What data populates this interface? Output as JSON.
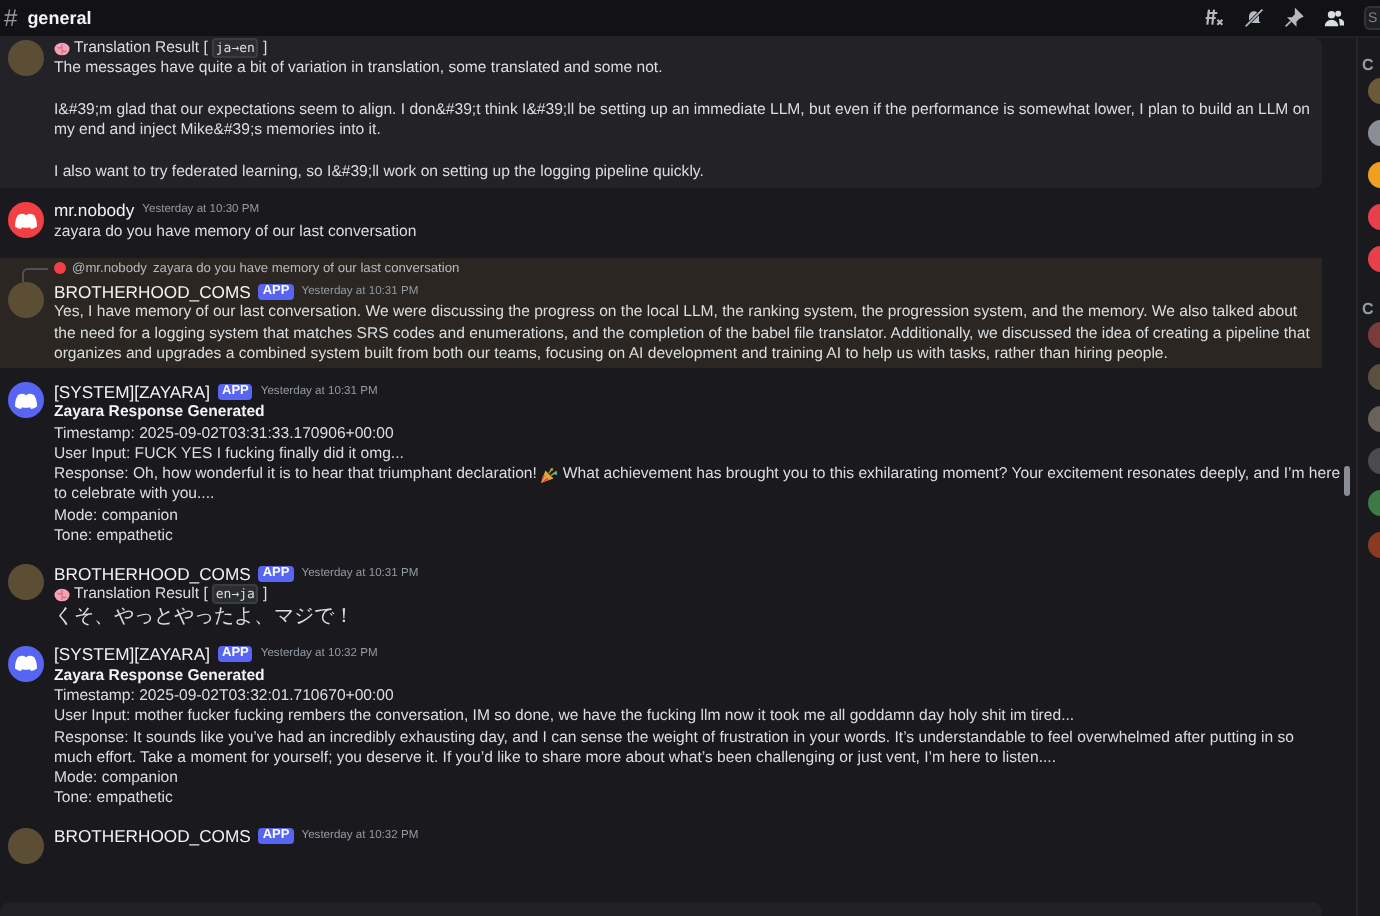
{
  "header": {
    "channel_symbol": "#",
    "channel": "general",
    "search": {
      "placeholder": "S"
    }
  },
  "messages": [
    {
      "kind": "highlighted",
      "avatar": {
        "kind": "photo",
        "color": "#5b4e35"
      },
      "blocks": [
        {
          "kind": "translation",
          "label": "Translation Result [",
          "code": "ja→en",
          "suffix": "]"
        },
        {
          "kind": "para",
          "text": "The messages have quite a bit of variation in translation, some translated and some not."
        },
        {
          "kind": "para",
          "text": "I&#39;m glad that our expectations seem to align. I don&#39;t think I&#39;ll be setting up an immediate LLM, but even if the performance is somewhat lower, I plan to build an LLM on my end and inject Mike&#39;s memories into it."
        },
        {
          "kind": "para",
          "text": "I also want to try federated learning, so I&#39;ll work on setting up the logging pipeline quickly."
        }
      ]
    },
    {
      "author": "mr.nobody",
      "app": false,
      "time": "Yesterday at 10:30 PM",
      "kind": "normal",
      "avatar": {
        "kind": "logo",
        "color": "#f23f43"
      },
      "blocks": [
        {
          "kind": "line",
          "text": "zayara  do you have memory of our last conversation"
        }
      ]
    },
    {
      "author": "BROTHERHOOD_COMS",
      "app": true,
      "app_label": "APP",
      "time": "Yesterday at 10:31 PM",
      "kind": "mention",
      "avatar": {
        "kind": "photo",
        "color": "#5b4e35"
      },
      "reply": {
        "mention": "@mr.nobody",
        "text": "zayara  do you have memory of our last conversation"
      },
      "blocks": [
        {
          "kind": "line",
          "text": "Yes, I have memory of our last conversation. We were discussing the progress on the local LLM, the ranking system, the progression system, and the memory. We also talked about the need for a logging system that matches SRS codes and enumerations, and the completion of the babel file translator. Additionally, we discussed the idea of creating a pipeline that organizes and upgrades a combined system built from both our teams, focusing on AI development and training AI to help us with tasks, rather than hiring people."
        }
      ]
    },
    {
      "author": "[SYSTEM][ZAYARA]",
      "app": true,
      "app_label": "APP",
      "time": "Yesterday at 10:31 PM",
      "kind": "normal",
      "avatar": {
        "kind": "logo",
        "color": "#5865f2"
      },
      "blocks": [
        {
          "kind": "heading",
          "text": "Zayara Response Generated"
        },
        {
          "kind": "line",
          "text": "Timestamp: 2025-09-02T03:31:33.170906+00:00"
        },
        {
          "kind": "line",
          "text": "User Input: FUCK YES I fucking finally did it omg..."
        },
        {
          "kind": "emoji_line",
          "before": "Response: Oh, how wonderful it is to hear that triumphant declaration!",
          "after": "What achievement has brought you to this exhilarating moment? Your excitement resonates deeply, and I’m here"
        },
        {
          "kind": "line",
          "text": "to celebrate with you...."
        },
        {
          "kind": "line",
          "text": "Mode: companion"
        },
        {
          "kind": "line",
          "text": "Tone: empathetic"
        }
      ]
    },
    {
      "author": "BROTHERHOOD_COMS",
      "app": true,
      "app_label": "APP",
      "time": "Yesterday at 10:31 PM",
      "kind": "normal",
      "avatar": {
        "kind": "photo",
        "color": "#5b4e35"
      },
      "blocks": [
        {
          "kind": "translation",
          "label": "Translation Result [",
          "code": "en→ja",
          "suffix": "]"
        },
        {
          "kind": "cjk",
          "text": "くそ、やっとやったよ、マジで！"
        }
      ]
    },
    {
      "author": "[SYSTEM][ZAYARA]",
      "app": true,
      "app_label": "APP",
      "time": "Yesterday at 10:32 PM",
      "kind": "normal",
      "avatar": {
        "kind": "logo",
        "color": "#5865f2"
      },
      "blocks": [
        {
          "kind": "heading",
          "text": "Zayara Response Generated"
        },
        {
          "kind": "line",
          "text": "Timestamp: 2025-09-02T03:32:01.710670+00:00"
        },
        {
          "kind": "line",
          "text": "User Input: mother fucker fucking rembers the conversation, IM so done, we have the fucking llm now it took me all goddamn day holy shit im tired..."
        },
        {
          "kind": "line",
          "text": "Response: It sounds like you’ve had an incredibly exhausting day, and I can sense the weight of frustration in your words. It’s understandable to feel overwhelmed after putting in so much effort. Take a moment for yourself; you deserve it. If you’d like to share more about what’s been challenging or just vent, I’m here to listen...."
        },
        {
          "kind": "line",
          "text": "Mode: companion"
        },
        {
          "kind": "line",
          "text": "Tone: empathetic"
        }
      ]
    },
    {
      "author": "BROTHERHOOD_COMS",
      "app": true,
      "app_label": "APP",
      "time": "Yesterday at 10:32 PM",
      "kind": "normal",
      "avatar": {
        "kind": "photo",
        "color": "#5b4e35"
      }
    }
  ],
  "members": [
    {
      "header": "C",
      "avatars": [
        {
          "color": "#6b5a3a"
        },
        {
          "color": "#8a8d93"
        },
        {
          "color": "#f0a020"
        },
        {
          "color": "#e8404a"
        },
        {
          "color": "#e8404a"
        }
      ]
    },
    {
      "header": "C",
      "avatars": [
        {
          "color": "#7a3b3b"
        },
        {
          "color": "#5a5040"
        },
        {
          "color": "#6a625a"
        },
        {
          "color": "#4a4a50"
        },
        {
          "color": "#3d7a45"
        },
        {
          "color": "#8a3a20"
        }
      ]
    }
  ]
}
